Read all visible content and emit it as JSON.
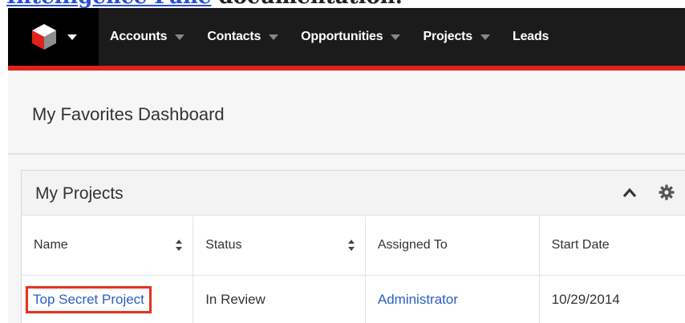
{
  "doc": {
    "link_text": "Intelligence Pane",
    "trailing_text": " documentation."
  },
  "navbar": {
    "logo_icon": "sugar-cube-logo",
    "items": [
      {
        "label": "Accounts"
      },
      {
        "label": "Contacts"
      },
      {
        "label": "Opportunities"
      },
      {
        "label": "Projects"
      },
      {
        "label": "Leads"
      }
    ],
    "accent_color": "#e2231a"
  },
  "dashboard": {
    "title": "My Favorites Dashboard"
  },
  "dashlet": {
    "title": "My Projects",
    "columns": [
      "Name",
      "Status",
      "Assigned To",
      "Start Date"
    ],
    "rows": [
      {
        "name": "Top Secret Project",
        "status": "In Review",
        "assigned_to": "Administrator",
        "start_date": "10/29/2014"
      }
    ]
  }
}
